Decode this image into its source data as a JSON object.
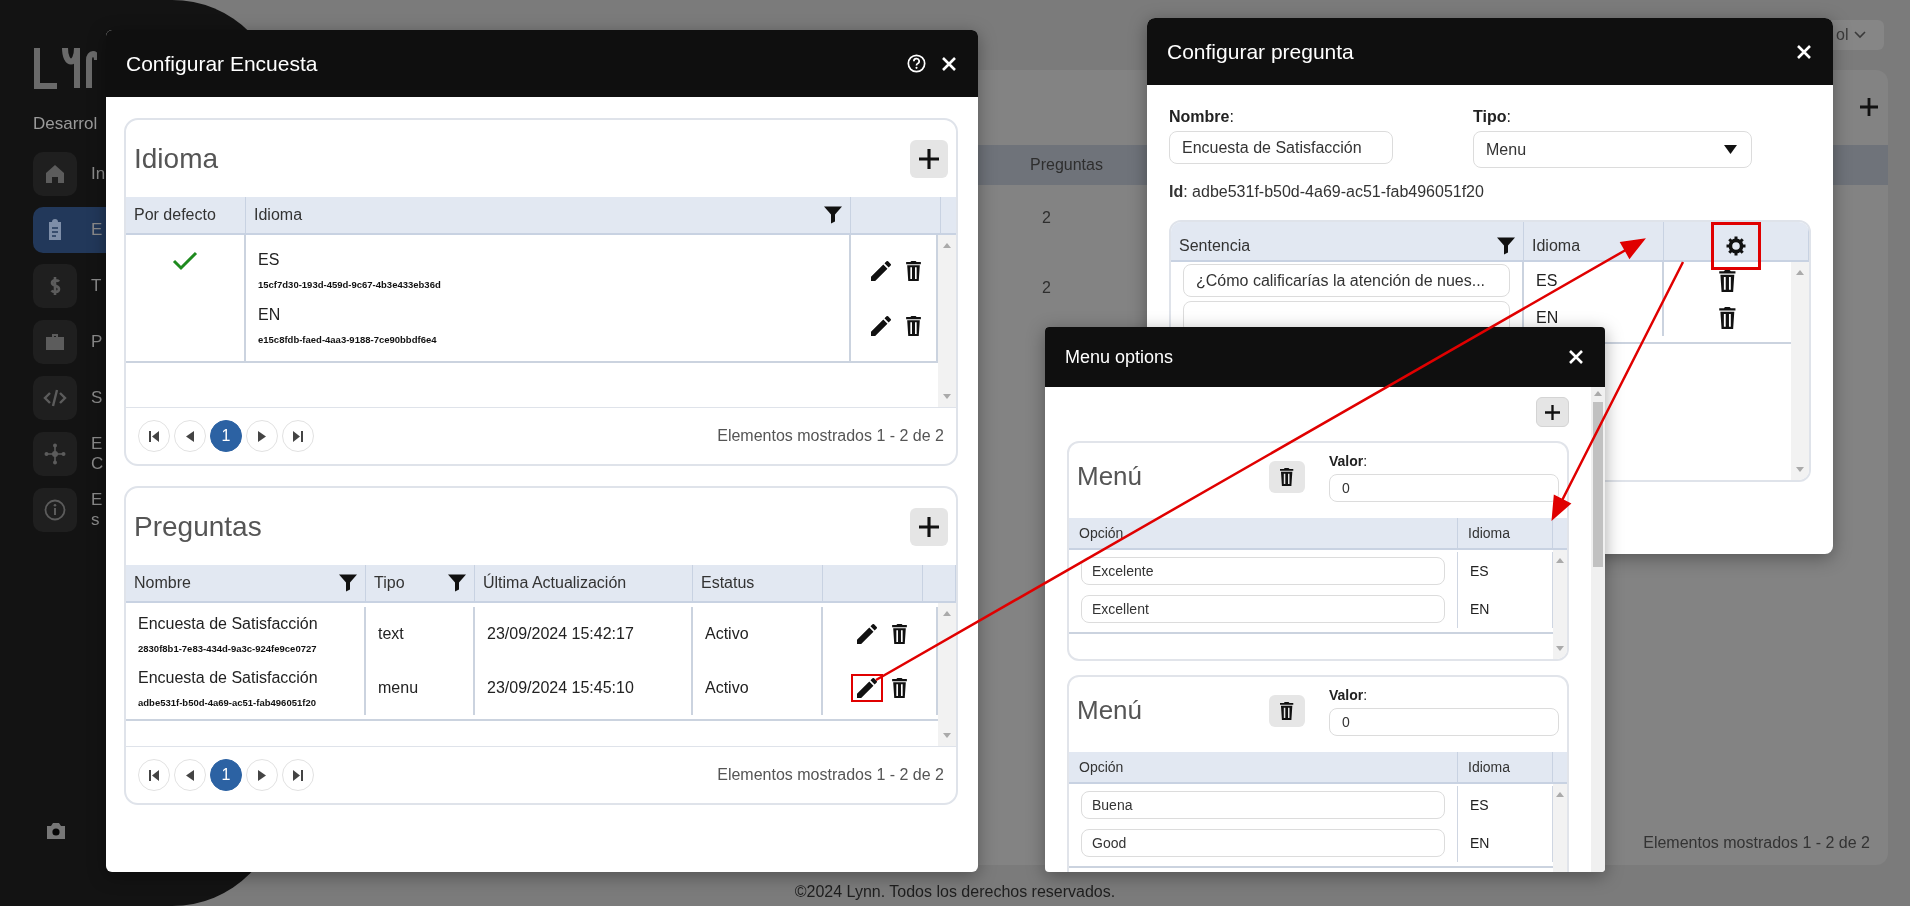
{
  "sidebar": {
    "subtitle": "Desarrol",
    "items": [
      {
        "lines": [
          "In"
        ],
        "selected": false
      },
      {
        "lines": [
          "E"
        ],
        "selected": true
      },
      {
        "lines": [
          "T"
        ],
        "selected": false
      },
      {
        "lines": [
          "P"
        ],
        "selected": false
      },
      {
        "lines": [
          "S"
        ],
        "selected": false
      },
      {
        "lines": [
          "E",
          "C"
        ],
        "selected": false
      },
      {
        "lines": [
          "E",
          "s"
        ],
        "selected": false
      }
    ]
  },
  "language_selector": {
    "value": "ol"
  },
  "background_table": {
    "column": "Preguntas",
    "cells": [
      "2",
      "2"
    ],
    "summary": "Elementos mostrados 1 - 2 de 2"
  },
  "footer": "©2024 Lynn. Todos los derechos reservados.",
  "survey_dialog": {
    "title": "Configurar Encuesta",
    "languages": {
      "title": "Idioma",
      "columns": [
        {
          "label": "Por defecto",
          "filter": false
        },
        {
          "label": "Idioma",
          "filter": true
        }
      ],
      "rows": [
        {
          "default": true,
          "code": "ES",
          "id": "15cf7d30-193d-459d-9c67-4b3e433eb36d"
        },
        {
          "default": false,
          "code": "EN",
          "id": "e15c8fdb-faed-4aa3-9188-7ce90bbdf6e4"
        }
      ],
      "pages": [
        {
          "label": "1",
          "selected": true
        }
      ],
      "summary": "Elementos mostrados 1 - 2 de 2"
    },
    "questions": {
      "title": "Preguntas",
      "columns": [
        {
          "label": "Nombre",
          "filter": true
        },
        {
          "label": "Tipo",
          "filter": true
        },
        {
          "label": "Última Actualización",
          "filter": false
        },
        {
          "label": "Estatus",
          "filter": false
        }
      ],
      "rows": [
        {
          "name": "Encuesta de Satisfacción",
          "id": "2830f8b1-7e83-434d-9a3c-924fe9ce0727",
          "type": "text",
          "updated": "23/09/2024 15:42:17",
          "status": "Activo",
          "highlighted": false
        },
        {
          "name": "Encuesta de Satisfacción",
          "id": "adbe531f-b50d-4a69-ac51-fab496051f20",
          "type": "menu",
          "updated": "23/09/2024 15:45:10",
          "status": "Activo",
          "highlighted": true
        }
      ],
      "pages": [
        {
          "label": "1",
          "selected": true
        }
      ],
      "summary": "Elementos mostrados 1 - 2 de 2"
    }
  },
  "question_dialog": {
    "title": "Configurar pregunta",
    "name_label": "**Nombre**:",
    "name_value": "Encuesta de Satisfacción",
    "type_label": "**Tipo**:",
    "type_value": "Menu",
    "id_line": "**Id**: adbe531f-b50d-4a69-ac51-fab496051f20",
    "columns": [
      {
        "label": "Sentencia",
        "filter": true
      },
      {
        "label": "Idioma",
        "filter": false
      }
    ],
    "settings_highlighted": true,
    "rows": [
      {
        "sentence": "¿Cómo calificarías la atención de nues...",
        "language": "ES"
      },
      {
        "language": "EN"
      }
    ]
  },
  "menu_dialog": {
    "title": "Menu options",
    "menus": [
      {
        "title": "Menú",
        "value_label": "**Valor**:",
        "value": "0",
        "columns": [
          "Opción",
          "Idioma"
        ],
        "options": [
          {
            "text": "Excelente",
            "language": "ES"
          },
          {
            "text": "Excellent",
            "language": "EN"
          }
        ]
      },
      {
        "title": "Menú",
        "value_label": "**Valor**:",
        "value": "0",
        "columns": [
          "Opción",
          "Idioma"
        ],
        "options": [
          {
            "text": "Buena",
            "language": "ES"
          },
          {
            "text": "Good",
            "language": "EN"
          }
        ]
      }
    ]
  }
}
